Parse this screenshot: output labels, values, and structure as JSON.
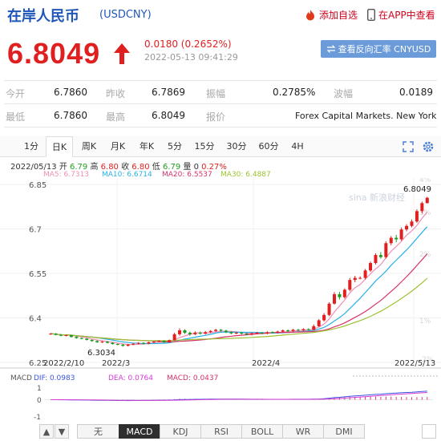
{
  "header": {
    "name": "在岸人民币",
    "code": "(USDCNY)",
    "add_label": "添加自选",
    "app_label": "在APP中查看"
  },
  "quote": {
    "price": "6.8049",
    "change": "0.0180 (0.2652%)",
    "timestamp": "2022-05-13 09:41:29",
    "exchange_button": "查看反向汇率 CNYUSD",
    "up_color": "#e02020"
  },
  "stats": {
    "row1": [
      {
        "label": "今开",
        "value": "6.7860"
      },
      {
        "label": "昨收",
        "value": "6.7869"
      },
      {
        "label": "振幅",
        "value": "0.2785%"
      },
      {
        "label": "波幅",
        "value": "0.0189"
      }
    ],
    "row2": [
      {
        "label": "最低",
        "value": "6.7860"
      },
      {
        "label": "最高",
        "value": "6.8049"
      },
      {
        "label": "报价",
        "value": "Forex Capital Markets. New York"
      }
    ]
  },
  "tabs": [
    "1分",
    "日K",
    "周K",
    "月K",
    "年K",
    "5分",
    "15分",
    "30分",
    "60分",
    "4H"
  ],
  "active_tab": "日K",
  "kline_info": {
    "date": "2022/05/13",
    "open_label": "开",
    "open": "6.79",
    "high_label": "高",
    "high": "6.80",
    "close_label": "收",
    "close": "6.80",
    "low_label": "低",
    "low": "6.79",
    "vol_label": "量",
    "vol": "0",
    "change": "0.27%"
  },
  "ma_legend": [
    {
      "label": "MA5: 6.7313",
      "color": "#ef8fb5"
    },
    {
      "label": "MA10: 6.6714",
      "color": "#2ab0e6"
    },
    {
      "label": "MA20: 6.5537",
      "color": "#d8326a"
    },
    {
      "label": "MA30: 6.4887",
      "color": "#9cc232"
    }
  ],
  "chart_data": {
    "type": "candlestick",
    "y_ticks": [
      "6.85",
      "6.7",
      "6.55",
      "6.4",
      "6.25"
    ],
    "pct_ticks": [
      "4%",
      "3%",
      "2%",
      "1%",
      "-2%"
    ],
    "x_ticks": [
      "2022/2/10",
      "2022/3",
      "2022/4",
      "2022/5/13"
    ],
    "ylim": [
      6.25,
      6.85
    ],
    "max_label": "6.8049",
    "min_label": "6.3034",
    "watermark": "sina 新浪财经",
    "candles": [
      [
        6.345,
        6.347,
        6.349,
        6.343
      ],
      [
        6.347,
        6.343,
        6.349,
        6.341
      ],
      [
        6.343,
        6.34,
        6.346,
        6.338
      ],
      [
        6.34,
        6.342,
        6.344,
        6.338
      ],
      [
        6.342,
        6.336,
        6.344,
        6.334
      ],
      [
        6.336,
        6.332,
        6.338,
        6.33
      ],
      [
        6.332,
        6.33,
        6.334,
        6.328
      ],
      [
        6.33,
        6.326,
        6.332,
        6.324
      ],
      [
        6.326,
        6.322,
        6.328,
        6.32
      ],
      [
        6.322,
        6.318,
        6.325,
        6.316
      ],
      [
        6.318,
        6.32,
        6.322,
        6.316
      ],
      [
        6.32,
        6.316,
        6.322,
        6.314
      ],
      [
        6.316,
        6.312,
        6.318,
        6.31
      ],
      [
        6.312,
        6.31,
        6.314,
        6.308
      ],
      [
        6.31,
        6.306,
        6.313,
        6.303
      ],
      [
        6.306,
        6.31,
        6.312,
        6.304
      ],
      [
        6.31,
        6.313,
        6.315,
        6.308
      ],
      [
        6.313,
        6.316,
        6.318,
        6.311
      ],
      [
        6.316,
        6.313,
        6.318,
        6.311
      ],
      [
        6.313,
        6.318,
        6.32,
        6.311
      ],
      [
        6.318,
        6.32,
        6.322,
        6.316
      ],
      [
        6.32,
        6.323,
        6.325,
        6.318
      ],
      [
        6.323,
        6.318,
        6.325,
        6.316
      ],
      [
        6.318,
        6.325,
        6.327,
        6.316
      ],
      [
        6.325,
        6.345,
        6.35,
        6.323
      ],
      [
        6.345,
        6.358,
        6.365,
        6.34
      ],
      [
        6.358,
        6.35,
        6.362,
        6.346
      ],
      [
        6.35,
        6.345,
        6.354,
        6.34
      ],
      [
        6.345,
        6.35,
        6.355,
        6.342
      ],
      [
        6.35,
        6.347,
        6.354,
        6.344
      ],
      [
        6.347,
        6.352,
        6.356,
        6.344
      ],
      [
        6.352,
        6.356,
        6.359,
        6.349
      ],
      [
        6.356,
        6.36,
        6.363,
        6.353
      ],
      [
        6.36,
        6.357,
        6.363,
        6.354
      ],
      [
        6.357,
        6.352,
        6.36,
        6.349
      ],
      [
        6.352,
        6.348,
        6.355,
        6.345
      ],
      [
        6.348,
        6.35,
        6.353,
        6.345
      ],
      [
        6.35,
        6.347,
        6.353,
        6.344
      ],
      [
        6.347,
        6.344,
        6.35,
        6.341
      ],
      [
        6.344,
        6.348,
        6.351,
        6.341
      ],
      [
        6.348,
        6.35,
        6.353,
        6.345
      ],
      [
        6.35,
        6.348,
        6.353,
        6.345
      ],
      [
        6.348,
        6.352,
        6.355,
        6.345
      ],
      [
        6.352,
        6.35,
        6.355,
        6.347
      ],
      [
        6.35,
        6.354,
        6.357,
        6.347
      ],
      [
        6.354,
        6.358,
        6.361,
        6.351
      ],
      [
        6.358,
        6.356,
        6.361,
        6.353
      ],
      [
        6.356,
        6.36,
        6.363,
        6.353
      ],
      [
        6.36,
        6.358,
        6.363,
        6.355
      ],
      [
        6.358,
        6.362,
        6.365,
        6.355
      ],
      [
        6.362,
        6.36,
        6.365,
        6.357
      ],
      [
        6.36,
        6.372,
        6.378,
        6.358
      ],
      [
        6.372,
        6.392,
        6.396,
        6.37
      ],
      [
        6.392,
        6.41,
        6.416,
        6.388
      ],
      [
        6.41,
        6.448,
        6.453,
        6.406
      ],
      [
        6.448,
        6.48,
        6.487,
        6.445
      ],
      [
        6.48,
        6.47,
        6.488,
        6.462
      ],
      [
        6.47,
        6.495,
        6.5,
        6.465
      ],
      [
        6.495,
        6.528,
        6.535,
        6.49
      ],
      [
        6.528,
        6.535,
        6.542,
        6.52
      ],
      [
        6.535,
        6.535,
        6.54,
        6.53
      ],
      [
        6.535,
        6.56,
        6.565,
        6.53
      ],
      [
        6.56,
        6.585,
        6.59,
        6.555
      ],
      [
        6.585,
        6.612,
        6.618,
        6.58
      ],
      [
        6.612,
        6.605,
        6.622,
        6.6
      ],
      [
        6.605,
        6.652,
        6.658,
        6.6
      ],
      [
        6.652,
        6.67,
        6.676,
        6.645
      ],
      [
        6.67,
        6.665,
        6.68,
        6.655
      ],
      [
        6.665,
        6.698,
        6.705,
        6.66
      ],
      [
        6.698,
        6.71,
        6.716,
        6.692
      ],
      [
        6.71,
        6.725,
        6.732,
        6.705
      ],
      [
        6.725,
        6.76,
        6.766,
        6.72
      ],
      [
        6.76,
        6.787,
        6.792,
        6.752
      ],
      [
        6.787,
        6.805,
        6.808,
        6.786
      ]
    ]
  },
  "macd": {
    "title": "MACD",
    "dif": "DIF: 0.0983",
    "dea": "DEA: 0.0764",
    "macd": "MACD: 0.0437",
    "dif_color": "#3a55e0",
    "dea_color": "#d43bd6",
    "macd_color": "#d8326a",
    "y_ticks": [
      "1",
      "0",
      "-1"
    ]
  },
  "indicators": [
    "无",
    "MACD",
    "KDJ",
    "RSI",
    "BOLL",
    "WR",
    "DMI"
  ],
  "active_indicator": "MACD"
}
